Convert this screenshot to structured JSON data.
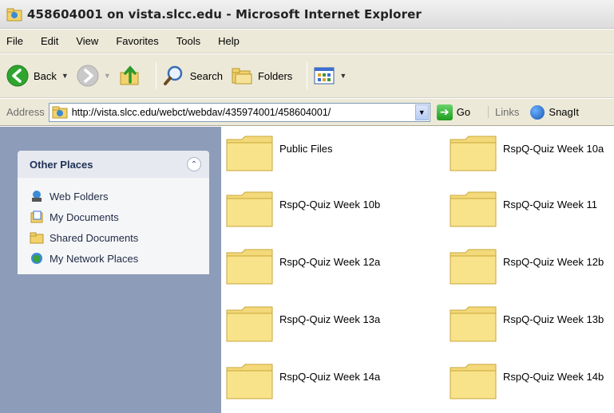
{
  "window": {
    "title": "458604001 on vista.slcc.edu - Microsoft Internet Explorer"
  },
  "menu": [
    "File",
    "Edit",
    "View",
    "Favorites",
    "Tools",
    "Help"
  ],
  "toolbar": {
    "back_label": "Back",
    "search_label": "Search",
    "folders_label": "Folders"
  },
  "address": {
    "label": "Address",
    "url": "http://vista.slcc.edu/webct/webdav/435974001/458604001/",
    "go_label": "Go",
    "links_label": "Links",
    "snagit_label": "SnagIt"
  },
  "other_places": {
    "title": "Other Places",
    "items": [
      {
        "label": "Web Folders",
        "icon": "web-folders-icon"
      },
      {
        "label": "My Documents",
        "icon": "my-documents-icon"
      },
      {
        "label": "Shared Documents",
        "icon": "shared-documents-icon"
      },
      {
        "label": "My Network Places",
        "icon": "network-places-icon"
      }
    ]
  },
  "folders": [
    "Public Files",
    "RspQ-Quiz Week 10a",
    "RspQ-Quiz Week 10b",
    "RspQ-Quiz Week 11",
    "RspQ-Quiz Week 12a",
    "RspQ-Quiz Week 12b",
    "RspQ-Quiz Week 13a",
    "RspQ-Quiz Week 13b",
    "RspQ-Quiz Week 14a",
    "RspQ-Quiz Week 14b"
  ],
  "colors": {
    "menu_bg": "#ece9d8",
    "folder_yellow": "#f8e38a",
    "pane_bg": "#8d9cb9"
  }
}
